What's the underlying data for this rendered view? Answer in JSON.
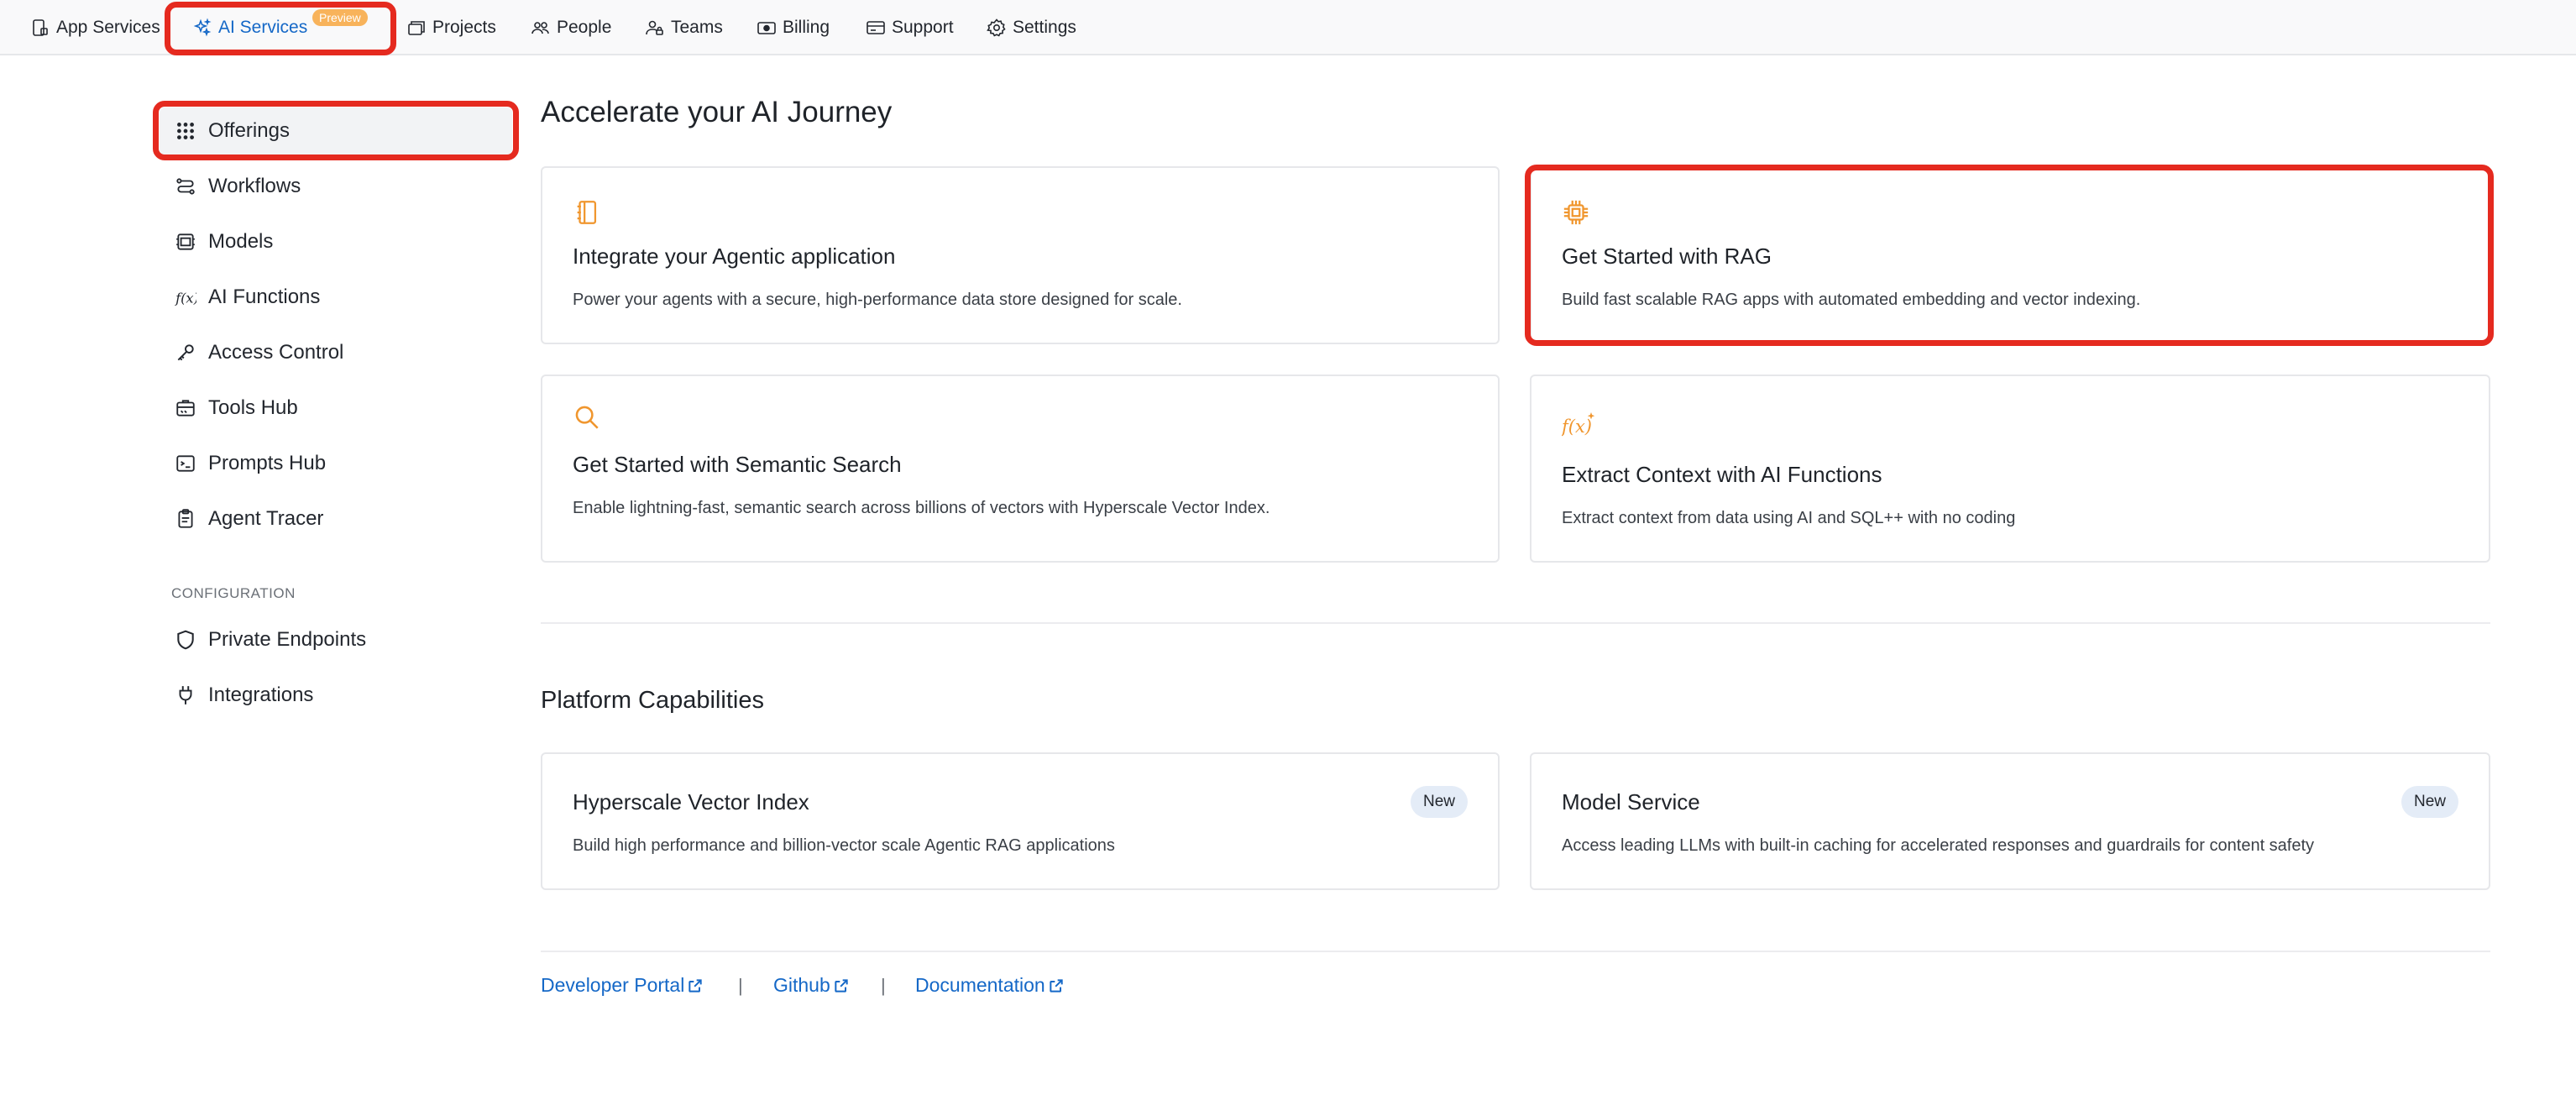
{
  "topnav": {
    "items": [
      {
        "label": "App Services",
        "icon": "app-services-icon"
      },
      {
        "label": "AI Services",
        "icon": "sparkle-icon",
        "badge": "Preview"
      },
      {
        "label": "Projects",
        "icon": "projects-icon"
      },
      {
        "label": "People",
        "icon": "people-icon"
      },
      {
        "label": "Teams",
        "icon": "teams-icon"
      },
      {
        "label": "Billing",
        "icon": "billing-icon"
      },
      {
        "label": "Support",
        "icon": "support-icon"
      },
      {
        "label": "Settings",
        "icon": "gear-icon"
      }
    ]
  },
  "sidebar": {
    "items": [
      {
        "label": "Offerings",
        "icon": "grid-icon"
      },
      {
        "label": "Workflows",
        "icon": "workflow-icon"
      },
      {
        "label": "Models",
        "icon": "models-icon"
      },
      {
        "label": "AI Functions",
        "icon": "function-icon"
      },
      {
        "label": "Access Control",
        "icon": "key-icon"
      },
      {
        "label": "Tools Hub",
        "icon": "tools-icon"
      },
      {
        "label": "Prompts Hub",
        "icon": "terminal-icon"
      },
      {
        "label": "Agent Tracer",
        "icon": "clipboard-icon"
      }
    ],
    "config_heading": "CONFIGURATION",
    "config_items": [
      {
        "label": "Private Endpoints",
        "icon": "shield-icon"
      },
      {
        "label": "Integrations",
        "icon": "plug-icon"
      }
    ]
  },
  "main": {
    "title": "Accelerate your AI Journey",
    "cards": [
      {
        "title": "Integrate your Agentic application",
        "desc": "Power your agents with a secure, high-performance data store designed for scale.",
        "icon": "notebook-icon"
      },
      {
        "title": "Get Started with RAG",
        "desc": "Build fast scalable RAG apps with automated embedding and vector indexing.",
        "icon": "chip-icon"
      },
      {
        "title": "Get Started with Semantic Search",
        "desc": "Enable lightning-fast, semantic search across billions of vectors with Hyperscale Vector Index.",
        "icon": "search-icon"
      },
      {
        "title": "Extract Context with AI Functions",
        "desc": "Extract context from data using AI and SQL++ with no coding",
        "icon": "function-sparkle-icon"
      }
    ],
    "platform_title": "Platform Capabilities",
    "platform_cards": [
      {
        "title": "Hyperscale Vector Index",
        "desc": "Build high performance and billion-vector scale Agentic RAG applications",
        "badge": "New"
      },
      {
        "title": "Model Service",
        "desc": "Access leading LLMs with built-in caching for accelerated responses and guardrails for content safety",
        "badge": "New"
      }
    ]
  },
  "footer": {
    "links": [
      "Developer Portal",
      "Github",
      "Documentation"
    ],
    "separator": "|"
  },
  "colors": {
    "accent": "#1568c7",
    "highlight": "#e52a1f",
    "icon_orange": "#f0962e",
    "preview_badge": "#f8b35b"
  }
}
